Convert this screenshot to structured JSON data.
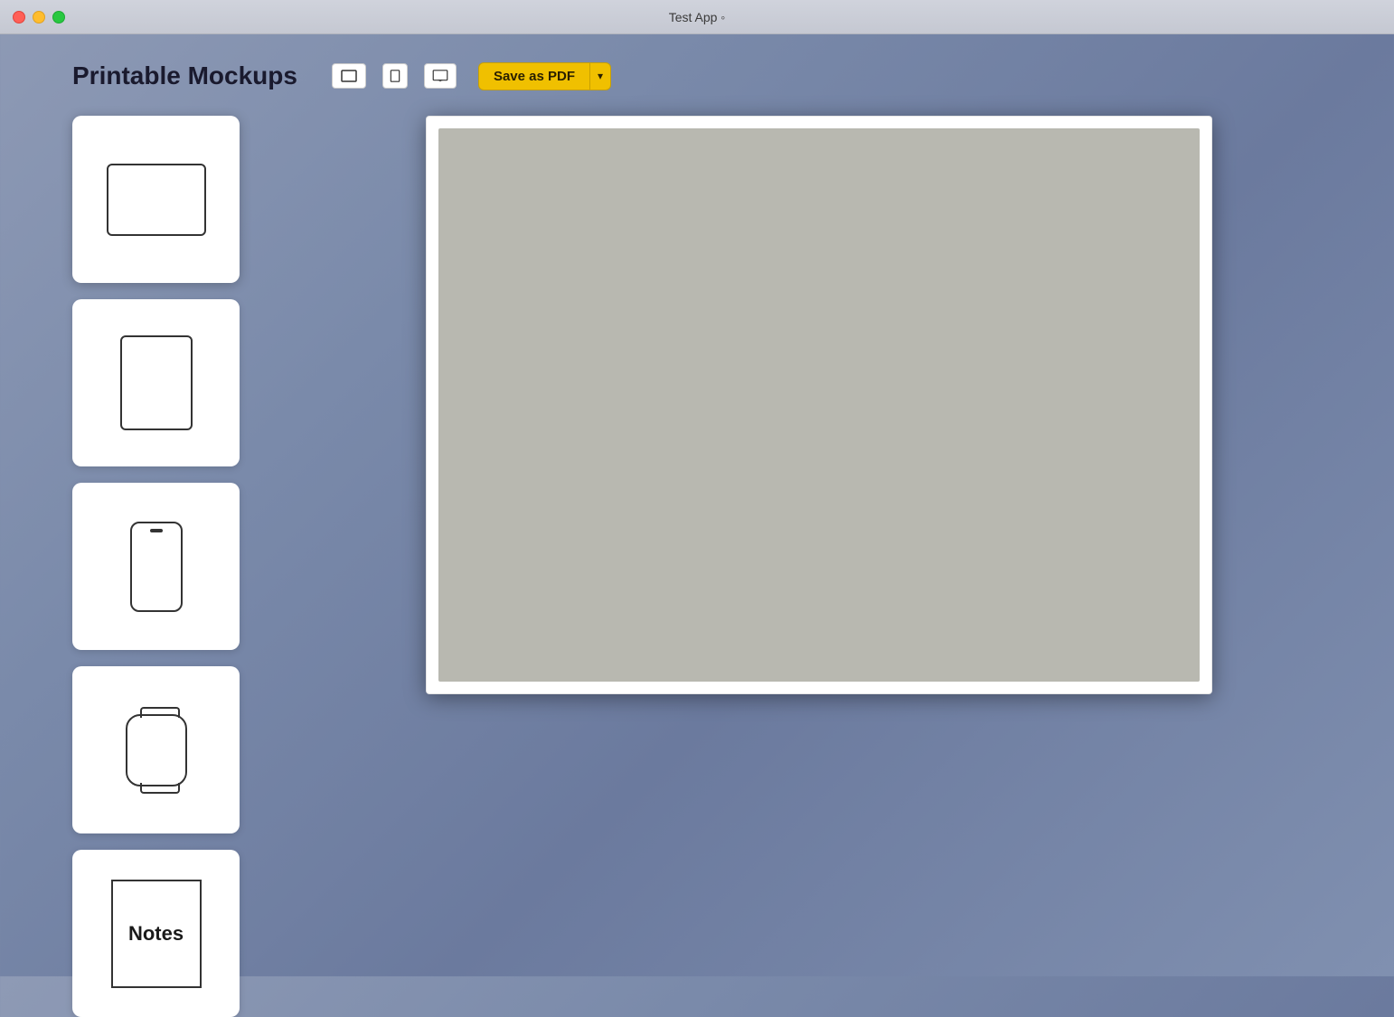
{
  "titleBar": {
    "title": "Test App ◦",
    "buttons": {
      "close": "close",
      "minimize": "minimize",
      "maximize": "maximize"
    }
  },
  "header": {
    "pageTitle": "Printable Mockups",
    "viewButtons": {
      "landscape": "landscape-view",
      "portrait": "portrait-view",
      "screen": "screen-view"
    },
    "savePdf": {
      "mainLabel": "Save as PDF",
      "dropdownLabel": "▾"
    }
  },
  "sidebar": {
    "items": [
      {
        "id": "laptop-landscape",
        "label": "Laptop Landscape",
        "type": "laptop-landscape"
      },
      {
        "id": "tablet-portrait",
        "label": "Tablet Portrait",
        "type": "tablet-portrait"
      },
      {
        "id": "phone",
        "label": "Phone",
        "type": "phone"
      },
      {
        "id": "watch",
        "label": "Watch",
        "type": "watch"
      },
      {
        "id": "notes",
        "label": "Notes",
        "type": "notes"
      }
    ]
  },
  "preview": {
    "label": "Preview Canvas"
  },
  "colors": {
    "background": "#8595b2",
    "titleBar": "#cdd0da",
    "savePdfYellow": "#f0c000",
    "previewBg": "#b8b8b0",
    "deviceStroke": "#333333",
    "cardBg": "#ffffff"
  }
}
